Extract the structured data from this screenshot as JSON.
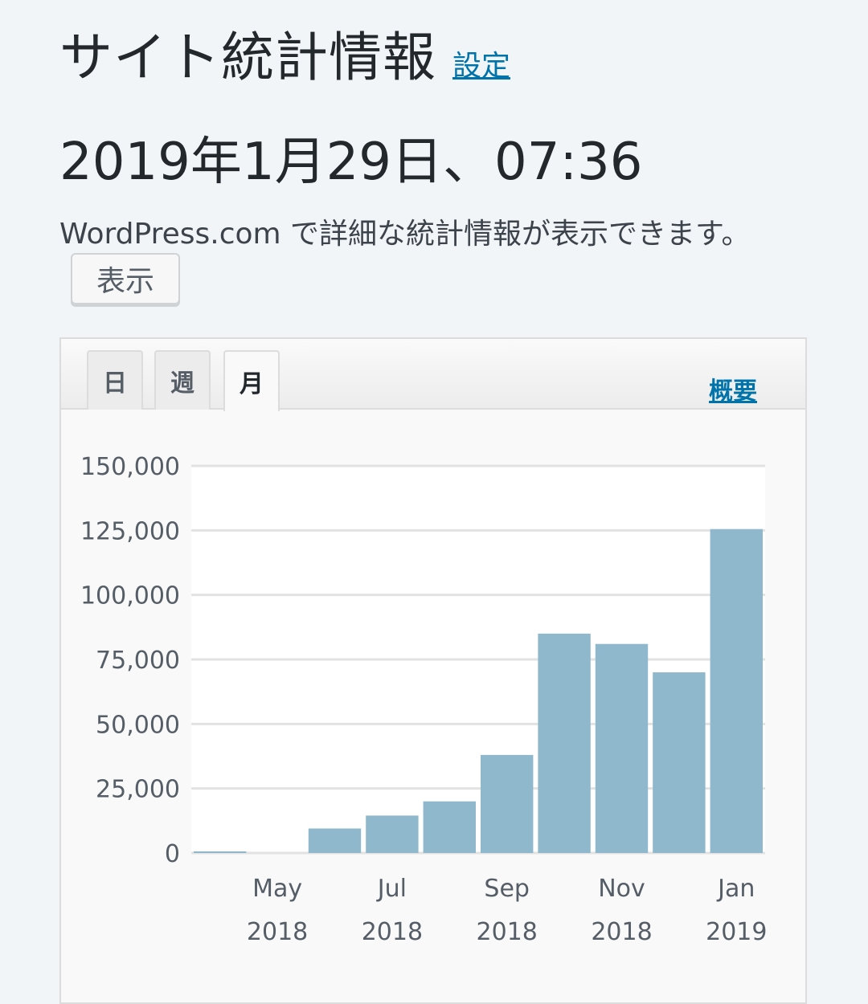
{
  "header": {
    "title": "サイト統計情報",
    "settings_label": "設定"
  },
  "datetime": "2019年1月29日、07:36",
  "notice": "WordPress.com で詳細な統計情報が表示できます。",
  "view_button_label": "表示",
  "tabs": [
    {
      "label": "日",
      "active": false
    },
    {
      "label": "週",
      "active": false
    },
    {
      "label": "月",
      "active": true
    }
  ],
  "summary_label": "概要",
  "colors": {
    "bar": "#8fb8cc",
    "link": "#0073aa"
  },
  "chart_data": {
    "type": "bar",
    "categories": [
      "Apr 2018",
      "May 2018",
      "Jun 2018",
      "Jul 2018",
      "Aug 2018",
      "Sep 2018",
      "Oct 2018",
      "Nov 2018",
      "Dec 2018",
      "Jan 2019"
    ],
    "values": [
      500,
      0,
      9500,
      14500,
      20000,
      38000,
      85000,
      81000,
      70000,
      125500
    ],
    "ylim": [
      0,
      150000
    ],
    "yticks": [
      "150,000",
      "125,000",
      "100,000",
      "75,000",
      "50,000",
      "25,000",
      "0"
    ],
    "ytick_values": [
      150000,
      125000,
      100000,
      75000,
      50000,
      25000,
      0
    ],
    "xtick_labels": [
      {
        "index": 1,
        "month": "May",
        "year": "2018"
      },
      {
        "index": 3,
        "month": "Jul",
        "year": "2018"
      },
      {
        "index": 5,
        "month": "Sep",
        "year": "2018"
      },
      {
        "index": 7,
        "month": "Nov",
        "year": "2018"
      },
      {
        "index": 9,
        "month": "Jan",
        "year": "2019"
      }
    ],
    "grid": true
  }
}
